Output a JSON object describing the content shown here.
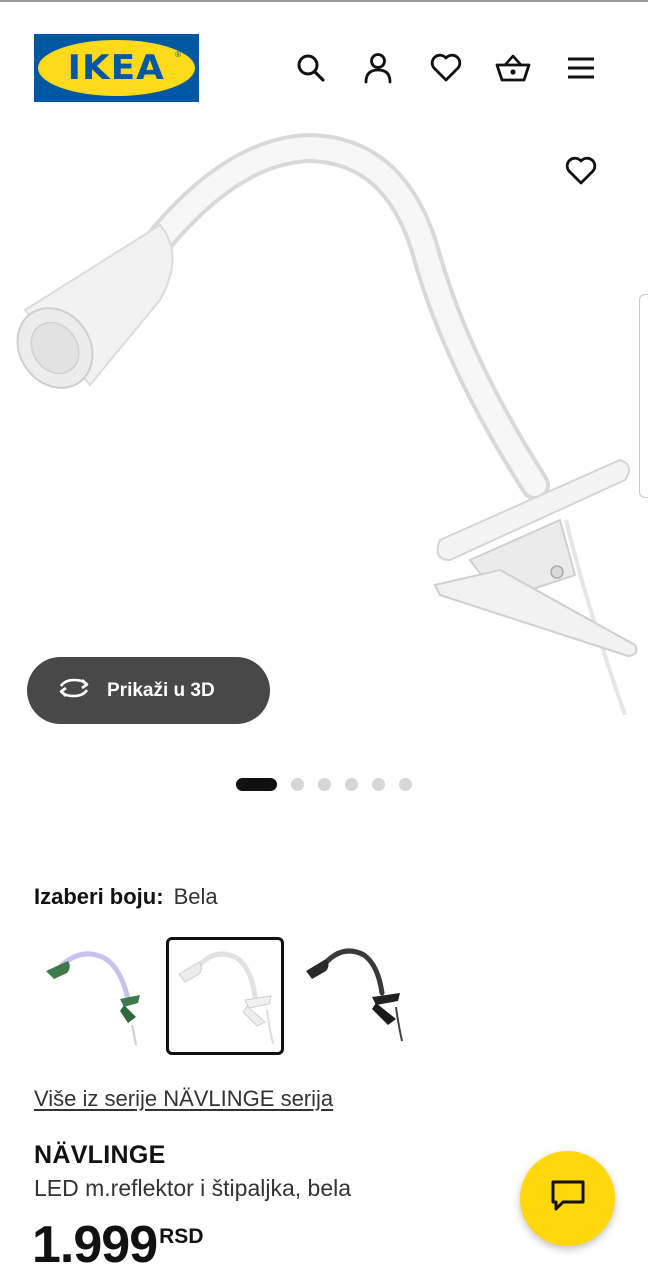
{
  "header": {
    "brand": "IKEA",
    "icons": [
      "search-icon",
      "user-icon",
      "heart-icon",
      "basket-icon",
      "menu-icon"
    ]
  },
  "gallery": {
    "view_3d_label": "Prikaži u 3D",
    "slide_count": 6,
    "active_slide": 1
  },
  "color_picker": {
    "label": "Izaberi boju:",
    "selected": "Bela",
    "swatches": [
      "green",
      "white",
      "black"
    ]
  },
  "series_link": "Više iz serije NÄVLINGE serija",
  "product": {
    "name": "NÄVLINGE",
    "description": "LED m.reflektor i štipaljka, bela",
    "price": "1.999",
    "currency": "RSD"
  },
  "colors": {
    "brand_blue": "#0058a3",
    "brand_yellow": "#ffda1a",
    "chat_yellow": "#ffd70a",
    "button_dark": "#484848"
  }
}
